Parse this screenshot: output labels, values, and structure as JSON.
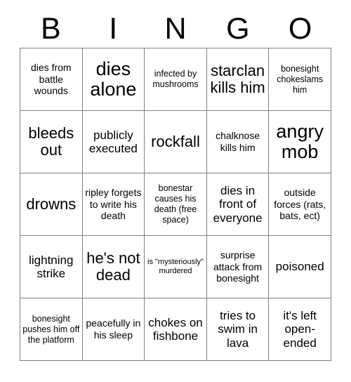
{
  "card": {
    "title": "BINGO",
    "header_letters": [
      "B",
      "I",
      "N",
      "G",
      "O"
    ],
    "columns": 5,
    "rows": 5,
    "border_color": "#808080",
    "text_color": "#000000",
    "background_color": "#ffffff",
    "free_space_label": "(free space)",
    "cells": [
      {
        "text": "dies from battle wounds",
        "size": "sm",
        "free": false
      },
      {
        "text": "dies alone",
        "size": "xl",
        "free": false
      },
      {
        "text": "infected by mushrooms",
        "size": "xs",
        "free": false
      },
      {
        "text": "starclan kills him",
        "size": "lg",
        "free": false
      },
      {
        "text": "bonesight chokeslams him",
        "size": "xs",
        "free": false
      },
      {
        "text": "bleeds out",
        "size": "lg",
        "free": false
      },
      {
        "text": "publicly executed",
        "size": "md",
        "free": false
      },
      {
        "text": "rockfall",
        "size": "lg",
        "free": false
      },
      {
        "text": "chalknose kills him",
        "size": "sm",
        "free": false
      },
      {
        "text": "angry mob",
        "size": "xl",
        "free": false
      },
      {
        "text": "drowns",
        "size": "lg",
        "free": false
      },
      {
        "text": "ripley forgets to write his death",
        "size": "sm",
        "free": false
      },
      {
        "text": "bonestar causes his death (free space)",
        "size": "xs",
        "free": true
      },
      {
        "text": "dies in front of everyone",
        "size": "md",
        "free": false
      },
      {
        "text": "outside forces (rats, bats, ect)",
        "size": "sm",
        "free": false
      },
      {
        "text": "lightning strike",
        "size": "md",
        "free": false
      },
      {
        "text": "he's not dead",
        "size": "lg",
        "free": false
      },
      {
        "text": "is \"mysteriously\" murdered",
        "size": "xxs",
        "free": false
      },
      {
        "text": "surprise attack from bonesight",
        "size": "sm",
        "free": false
      },
      {
        "text": "poisoned",
        "size": "md",
        "free": false
      },
      {
        "text": "bonesight pushes him off the platform",
        "size": "xs",
        "free": false
      },
      {
        "text": "peacefully in his sleep",
        "size": "sm",
        "free": false
      },
      {
        "text": "chokes on fishbone",
        "size": "md",
        "free": false
      },
      {
        "text": "tries to swim in lava",
        "size": "md",
        "free": false
      },
      {
        "text": "it's left open-ended",
        "size": "md",
        "free": false
      }
    ]
  }
}
